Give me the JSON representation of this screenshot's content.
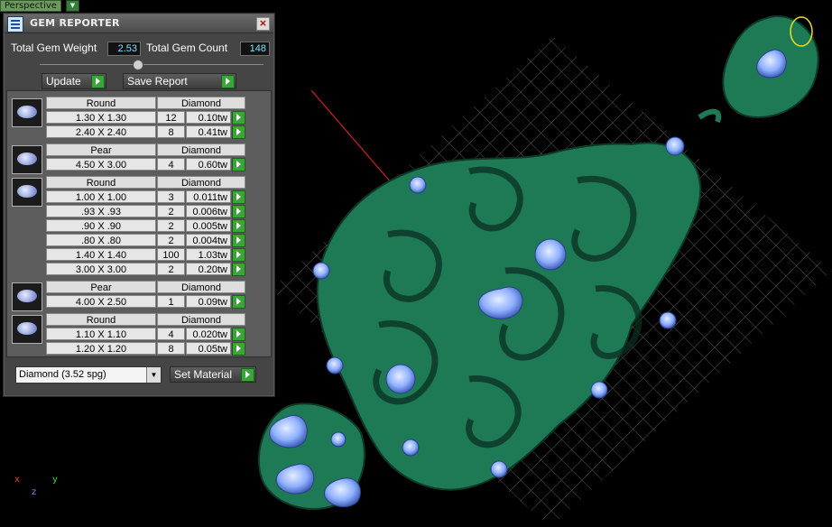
{
  "viewport": {
    "label": "Perspective",
    "axes": {
      "x": "x",
      "y": "y",
      "z": "z"
    }
  },
  "dialog": {
    "title": "GEM REPORTER",
    "total_weight_label": "Total Gem Weight",
    "total_weight_value": "2.53",
    "total_count_label": "Total Gem Count",
    "total_count_value": "148",
    "update_label": "Update",
    "save_report_label": "Save Report",
    "groups": [
      {
        "shape": "Round",
        "material": "Diamond",
        "icon": "round-gem-icon",
        "rows": [
          {
            "size": "1.30 X 1.30",
            "count": "12",
            "weight": "0.10tw"
          },
          {
            "size": "2.40 X 2.40",
            "count": "8",
            "weight": "0.41tw"
          }
        ]
      },
      {
        "shape": "Pear",
        "material": "Diamond",
        "icon": "pear-gem-icon",
        "rows": [
          {
            "size": "4.50 X 3.00",
            "count": "4",
            "weight": "0.60tw"
          }
        ]
      },
      {
        "shape": "Round",
        "material": "Diamond",
        "icon": "round-gem-icon",
        "rows": [
          {
            "size": "1.00 X 1.00",
            "count": "3",
            "weight": "0.011tw"
          },
          {
            "size": ".93 X .93",
            "count": "2",
            "weight": "0.006tw"
          },
          {
            "size": ".90 X .90",
            "count": "2",
            "weight": "0.005tw"
          },
          {
            "size": ".80 X .80",
            "count": "2",
            "weight": "0.004tw"
          },
          {
            "size": "1.40 X 1.40",
            "count": "100",
            "weight": "1.03tw"
          },
          {
            "size": "3.00 X 3.00",
            "count": "2",
            "weight": "0.20tw"
          }
        ]
      },
      {
        "shape": "Pear",
        "material": "Diamond",
        "icon": "pear-gem-icon",
        "rows": [
          {
            "size": "4.00 X 2.50",
            "count": "1",
            "weight": "0.09tw"
          }
        ]
      },
      {
        "shape": "Round",
        "material": "Diamond",
        "icon": "round-gem-icon",
        "rows": [
          {
            "size": "1.10 X 1.10",
            "count": "4",
            "weight": "0.020tw"
          },
          {
            "size": "1.20 X 1.20",
            "count": "8",
            "weight": "0.05tw"
          }
        ]
      }
    ],
    "material_select": "Diamond     (3.52 spg)",
    "set_material_label": "Set Material"
  },
  "colors": {
    "model": "#1e7a55",
    "grid": "#8a8a8a",
    "gem": "#8fb0ff",
    "panel": "#454545",
    "value_text": "#7fe0ff",
    "green_button": "#3aa63a"
  }
}
